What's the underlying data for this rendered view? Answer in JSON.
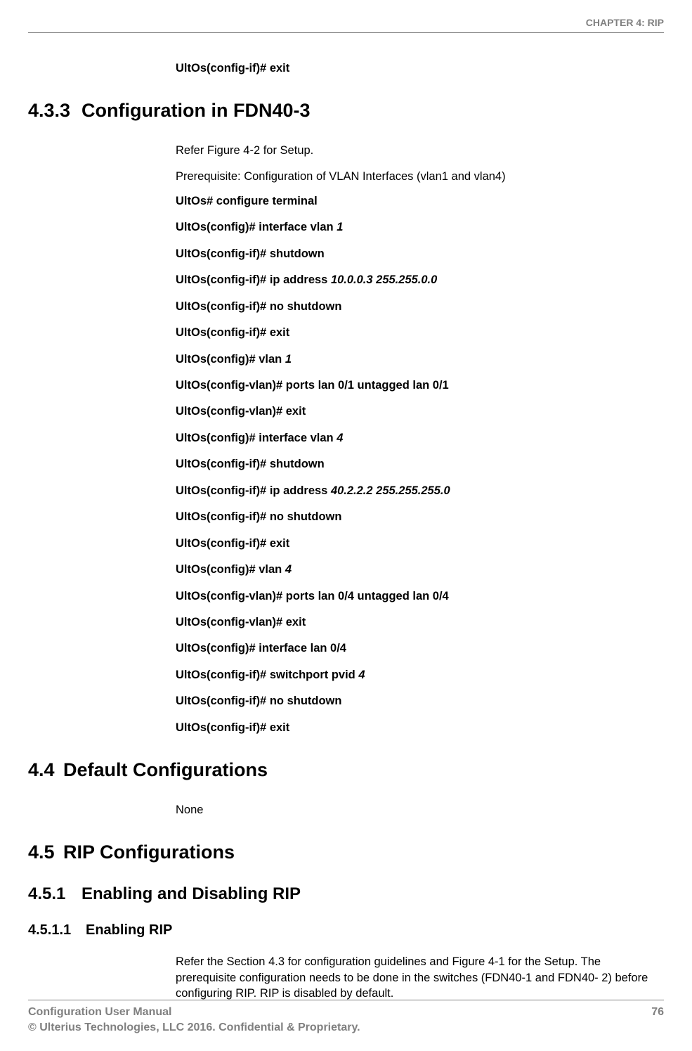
{
  "header": {
    "chapter": "CHAPTER 4: RIP"
  },
  "intro_cmd": "UltOs(config-if)# exit",
  "section_433": {
    "number": "4.3.3",
    "title": "Configuration in FDN40-3",
    "refer": "Refer Figure 4-2 for Setup.",
    "prereq": "Prerequisite: Configuration of VLAN Interfaces (vlan1 and vlan4)",
    "cmds": {
      "c01_a": "UltOs# configure terminal",
      "c02_a": "UltOs(config)# interface vlan ",
      "c02_b": "1",
      "c03_a": "UltOs(config-if)# shutdown",
      "c04_a": "UltOs(config-if)# ip address ",
      "c04_b": "10.0.0.3 255.255.0.0",
      "c05_a": "UltOs(config-if)# no shutdown",
      "c06_a": "UltOs(config-if)# exit",
      "c07_a": "UltOs(config)# vlan ",
      "c07_b": "1",
      "c08_a": "UltOs(config-vlan)# ports lan 0/1 untagged lan 0/1",
      "c09_a": "UltOs(config-vlan)# exit",
      "c10_a": "UltOs(config)# interface vlan ",
      "c10_b": "4",
      "c11_a": "UltOs(config-if)# shutdown",
      "c12_a": "UltOs(config-if)# ip address  ",
      "c12_b": "40.2.2.2 255.255.255.0",
      "c13_a": "UltOs(config-if)# no shutdown",
      "c14_a": "UltOs(config-if)# exit",
      "c15_a": "UltOs(config)# vlan ",
      "c15_b": "4",
      "c16_a": "UltOs(config-vlan)# ports lan 0/4 untagged lan 0/4",
      "c17_a": "UltOs(config-vlan)# exit",
      "c18_a": "UltOs(config)# interface lan 0/4",
      "c19_a": "UltOs(config-if)# switchport pvid ",
      "c19_b": "4",
      "c20_a": "UltOs(config-if)# no shutdown",
      "c21_a": "UltOs(config-if)# exit"
    }
  },
  "section_44": {
    "number": "4.4",
    "title": "Default Configurations",
    "body": "None"
  },
  "section_45": {
    "number": "4.5",
    "title": "RIP Configurations"
  },
  "section_451": {
    "number": "4.5.1",
    "title": "Enabling and Disabling RIP"
  },
  "section_4511": {
    "number": "4.5.1.1",
    "title": "Enabling RIP",
    "body": "Refer the Section 4.3 for configuration guidelines and Figure 4-1 for the Setup. The prerequisite configuration needs to be done in the switches (FDN40-1 and FDN40- 2) before configuring RIP. RIP is disabled by default."
  },
  "footer": {
    "left1": "Configuration User Manual",
    "right1": "76",
    "left2": "© Ulterius Technologies, LLC 2016. Confidential & Proprietary."
  }
}
